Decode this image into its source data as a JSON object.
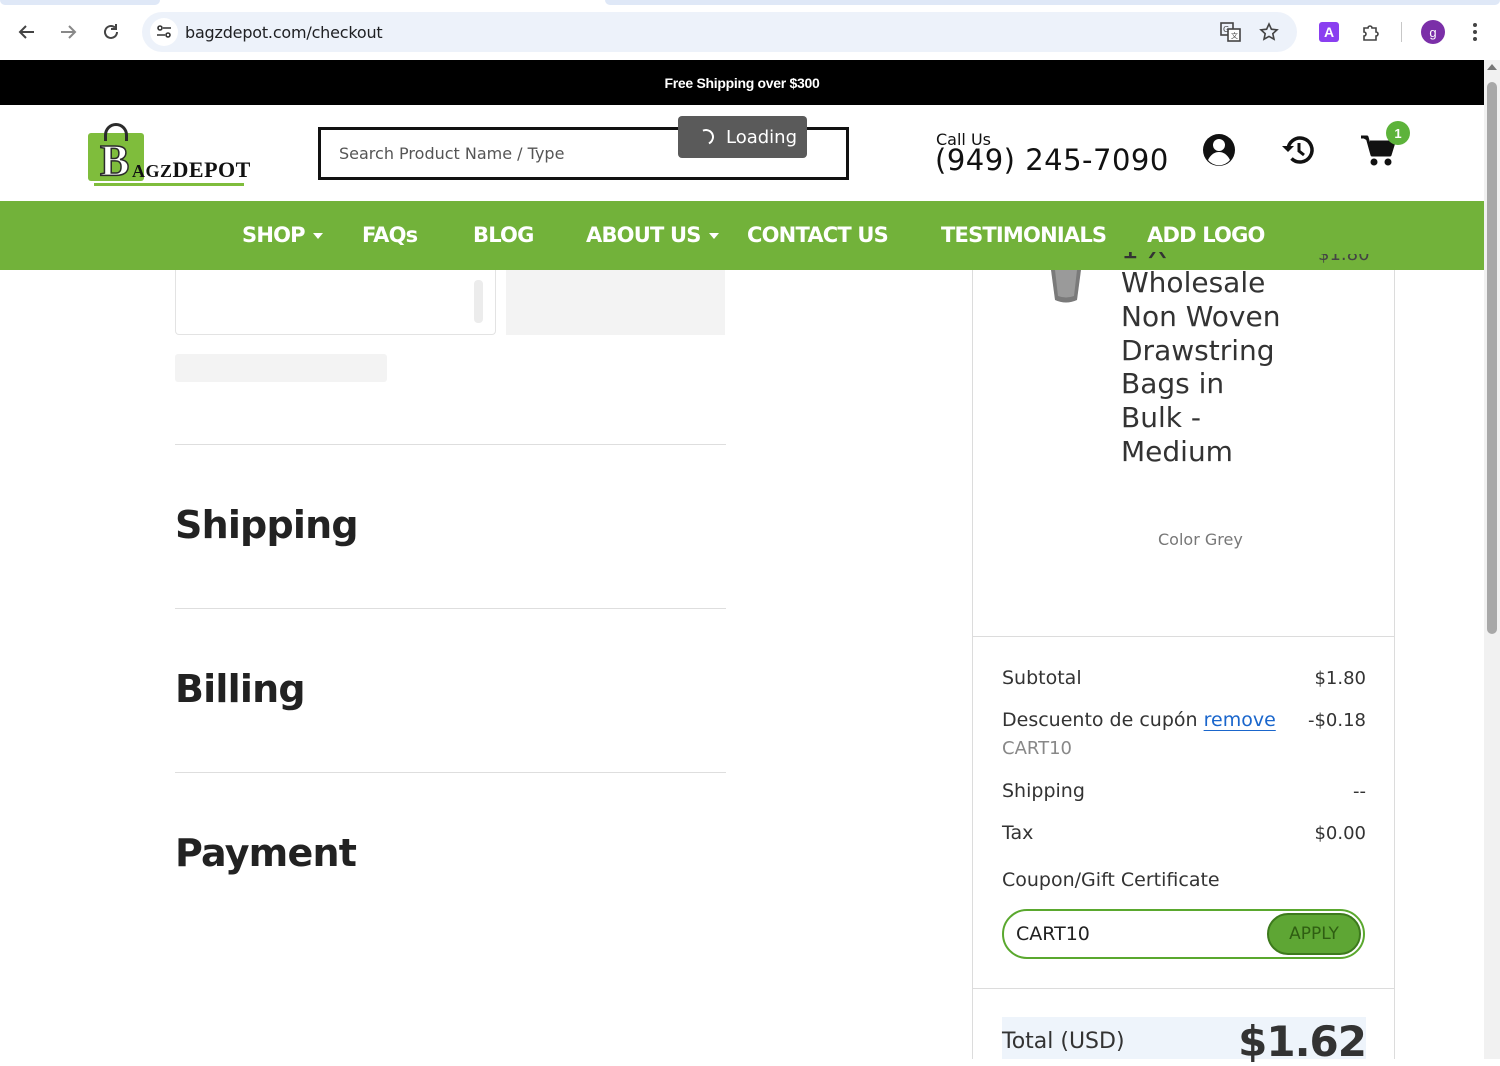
{
  "browser": {
    "url": "bagzdepot.com/checkout",
    "profile_initial": "g",
    "extension_letter": "A"
  },
  "site": {
    "announcement": "Free Shipping over $300",
    "logo": {
      "big_letter": "B",
      "rest": "AGZ",
      "word2": "DEPOT"
    },
    "search_placeholder": "Search Product Name / Type",
    "loading_label": "Loading",
    "call_label": "Call Us",
    "phone": "(949) 245-7090",
    "cart_count": "1",
    "colors": {
      "brand_green": "#72b23a",
      "link_blue": "#1a66cc"
    },
    "nav": [
      {
        "label": "SHOP",
        "dropdown": true
      },
      {
        "label": "FAQs",
        "dropdown": false
      },
      {
        "label": "BLOG",
        "dropdown": false
      },
      {
        "label": "ABOUT US",
        "dropdown": true
      },
      {
        "label": "CONTACT US",
        "dropdown": false
      },
      {
        "label": "TESTIMONIALS",
        "dropdown": false
      },
      {
        "label": "ADD LOGO",
        "dropdown": false
      }
    ]
  },
  "checkout": {
    "sections": [
      "Shipping",
      "Billing",
      "Payment"
    ]
  },
  "summary": {
    "product": {
      "qty_cut": "1 X",
      "name": "Wholesale Non Woven Drawstring Bags in Bulk - Medium",
      "price_cut": "$1.80",
      "attr_label": "Color",
      "attr_value": "Grey"
    },
    "subtotal_label": "Subtotal",
    "subtotal": "$1.80",
    "discount_label": "Descuento de cupón",
    "remove_label": "remove",
    "discount": "-$0.18",
    "applied_code": "CART10",
    "shipping_label": "Shipping",
    "shipping": "--",
    "tax_label": "Tax",
    "tax": "$0.00",
    "coupon_label": "Coupon/Gift Certificate",
    "coupon_value": "CART10",
    "apply_label": "APPLY",
    "total_label": "Total (USD)",
    "total": "$1.62"
  }
}
